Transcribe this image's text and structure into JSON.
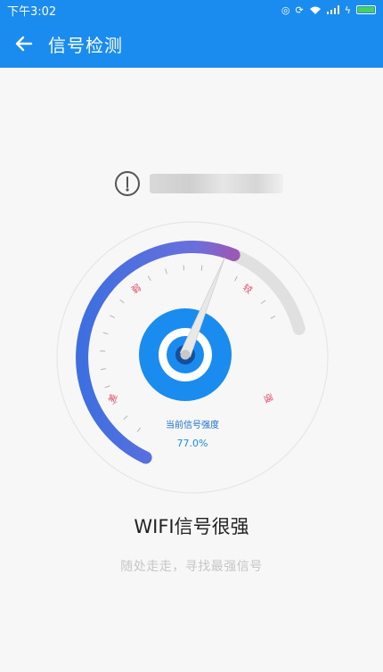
{
  "status_bar": {
    "time": "下午3:02",
    "icons": [
      "alarm-icon",
      "sync-icon",
      "wifi-icon",
      "signal-icon",
      "charging-icon",
      "battery-icon"
    ],
    "battery_color": "#46d15a"
  },
  "app_bar": {
    "title": "信号检测",
    "color": "#1a8cf0"
  },
  "network": {
    "name": "",
    "icon": "signal-info-icon"
  },
  "gauge": {
    "scale_labels": [
      "差",
      "弱",
      "较",
      "强"
    ],
    "caption": "当前信号强度",
    "value_text": "77.0%",
    "value": 0.77,
    "gradient_colors": [
      "#3d6fe0",
      "#9b59b6"
    ],
    "track_color": "#e0e0e0",
    "hub_color": "#1a8cf0"
  },
  "result": {
    "title": "WIFI信号很强",
    "hint": "随处走走，寻找最强信号"
  }
}
